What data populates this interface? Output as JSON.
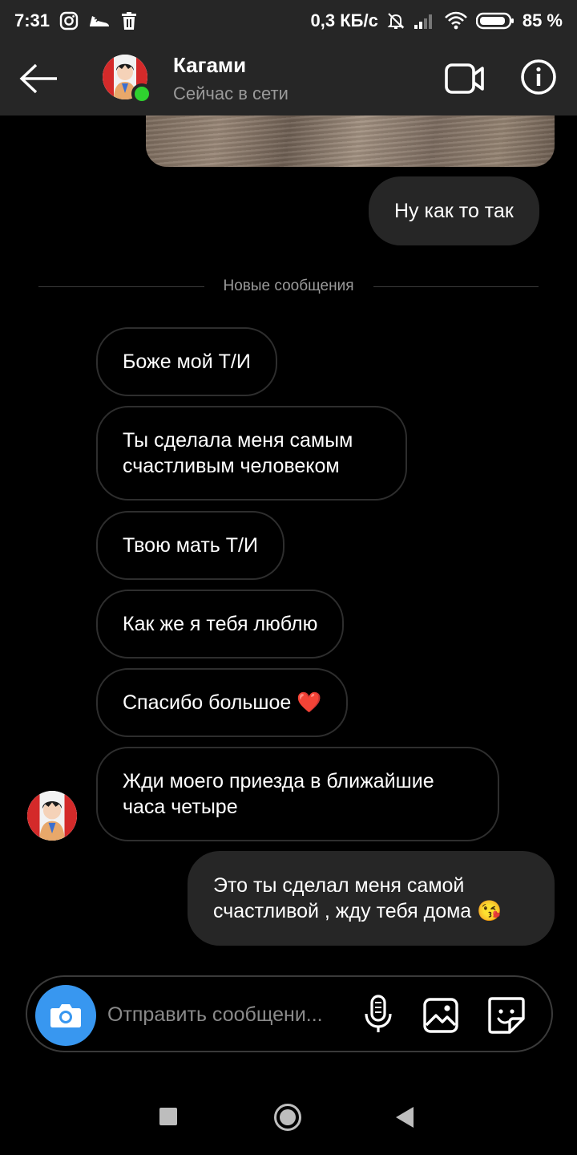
{
  "status_bar": {
    "time": "7:31",
    "speed": "0,3 КБ/с",
    "battery": "85 %",
    "icons": [
      "instagram-icon",
      "sneaker-icon",
      "trash-icon",
      "bell-off-icon",
      "signal-icon",
      "wifi-icon",
      "battery-icon"
    ]
  },
  "header": {
    "name": "Кагами",
    "status": "Сейчас в сети",
    "online_color": "#2fd12f"
  },
  "divider": {
    "label": "Новые сообщения"
  },
  "messages": {
    "out_1": "Ну как то так",
    "in_1": "Боже мой Т/И",
    "in_2": "Ты сделала меня самым счастливым человеком",
    "in_3": "Твою мать Т/И",
    "in_4": "Как же я тебя люблю",
    "in_5": "Спасибо большое ❤️",
    "in_6": "Жди моего приезда в ближайшие часа четыре",
    "out_2": "Это ты сделал меня самой счастливой , жду тебя дома 😘"
  },
  "composer": {
    "placeholder": "Отправить сообщени...",
    "accent": "#3897f0"
  },
  "colors": {
    "background": "#000000",
    "bar": "#262626",
    "outgoing_bubble": "#262626",
    "incoming_border": "#2e2e2e"
  }
}
